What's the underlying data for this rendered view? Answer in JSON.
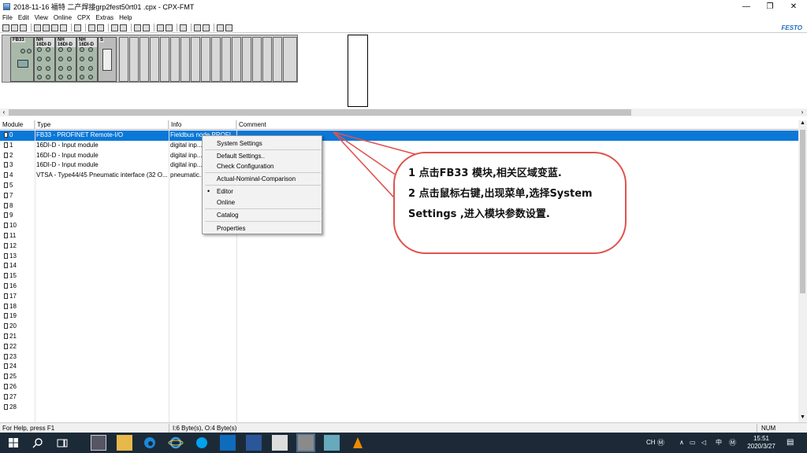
{
  "window": {
    "title": "2018-11-16 福特 二产焊接grp2fest50rt01 .cpx - CPX-FMT",
    "minimize": "—",
    "maximize": "❐",
    "close": "✕"
  },
  "menu": [
    "File",
    "Edit",
    "View",
    "Online",
    "CPX",
    "Extras",
    "Help"
  ],
  "brand": "FESTO",
  "hardware": {
    "modules": [
      "FB33",
      "NH",
      "NH",
      "NH",
      "S"
    ],
    "module_sublabels": [
      "",
      "16DI-D",
      "16DI-D",
      "16DI-D",
      ""
    ]
  },
  "table": {
    "columns": [
      "Module",
      "Type",
      "Info",
      "Comment"
    ],
    "rows": [
      {
        "module": "0",
        "type": "FB33 - PROFINET Remote-I/O",
        "info": "Fieldbus node PROFI...",
        "comment": "",
        "selected": true
      },
      {
        "module": "1",
        "type": "16DI-D - Input module",
        "info": "digital inp...",
        "comment": ""
      },
      {
        "module": "2",
        "type": "16DI-D - Input module",
        "info": "digital inp...",
        "comment": ""
      },
      {
        "module": "3",
        "type": "16DI-D - Input module",
        "info": "digital inp...",
        "comment": ""
      },
      {
        "module": "4",
        "type": "VTSA - Type44/45 Pneumatic interface (32 O...",
        "info": "pneumatic...",
        "comment": ""
      },
      {
        "module": "5"
      },
      {
        "module": "7"
      },
      {
        "module": "8"
      },
      {
        "module": "9"
      },
      {
        "module": "10"
      },
      {
        "module": "11"
      },
      {
        "module": "12"
      },
      {
        "module": "13"
      },
      {
        "module": "14"
      },
      {
        "module": "15"
      },
      {
        "module": "16"
      },
      {
        "module": "17"
      },
      {
        "module": "18"
      },
      {
        "module": "19"
      },
      {
        "module": "20"
      },
      {
        "module": "21"
      },
      {
        "module": "22"
      },
      {
        "module": "23"
      },
      {
        "module": "24"
      },
      {
        "module": "25"
      },
      {
        "module": "26"
      },
      {
        "module": "27"
      },
      {
        "module": "28"
      }
    ]
  },
  "context_menu": {
    "items": [
      "System Settings",
      "Default Settings..",
      "Check Configuration",
      "Actual-Nominal-Comparison",
      "Editor",
      "Online",
      "Catalog",
      "Properties"
    ]
  },
  "callout": {
    "line1": "1 点击FB33 模块,相关区域变蓝.",
    "line2": "2 点击鼠标右键,出现菜单,选择System",
    "line3": "Settings ,进入模块参数设置."
  },
  "status": {
    "help": "For Help, press F1",
    "bytes": "I:6 Byte(s), O:4 Byte(s)",
    "num": "NUM"
  },
  "taskbar": {
    "lang": "CH",
    "ime": "中",
    "time": "15:51",
    "date": "2020/3/27"
  },
  "colors": {
    "selection": "#0a78d7",
    "festo": "#1e6fc0",
    "callout": "#e0524f",
    "taskbar": "#1c2a38"
  }
}
